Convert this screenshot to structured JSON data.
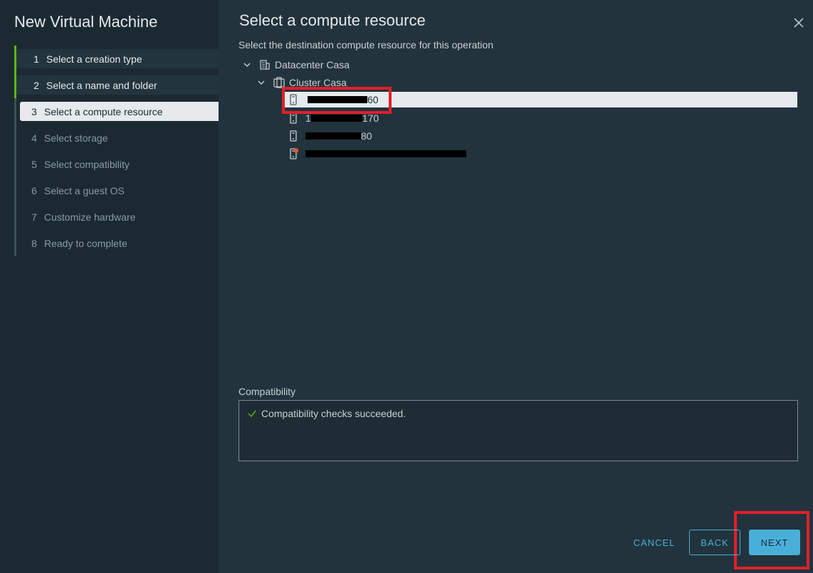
{
  "wizard": {
    "title": "New Virtual Machine",
    "steps": [
      {
        "num": "1",
        "label": "Select a creation type",
        "state": "done"
      },
      {
        "num": "2",
        "label": "Select a name and folder",
        "state": "done"
      },
      {
        "num": "3",
        "label": "Select a compute resource",
        "state": "current"
      },
      {
        "num": "4",
        "label": "Select storage",
        "state": "future"
      },
      {
        "num": "5",
        "label": "Select compatibility",
        "state": "future"
      },
      {
        "num": "6",
        "label": "Select a guest OS",
        "state": "future"
      },
      {
        "num": "7",
        "label": "Customize hardware",
        "state": "future"
      },
      {
        "num": "8",
        "label": "Ready to complete",
        "state": "future"
      }
    ]
  },
  "dialog": {
    "title": "Select a compute resource",
    "subtitle": "Select the destination compute resource for this operation",
    "close_icon": "close-icon"
  },
  "tree": {
    "datacenter": {
      "label": "Datacenter Casa",
      "icon": "datacenter-icon"
    },
    "cluster": {
      "label": "Cluster Casa",
      "icon": "cluster-icon"
    },
    "hosts": [
      {
        "visible_suffix": "60",
        "icon": "host-icon",
        "selected": true
      },
      {
        "visible_prefix": "1",
        "visible_suffix": "170",
        "icon": "host-icon",
        "selected": false
      },
      {
        "visible_suffix": "80",
        "icon": "host-icon",
        "selected": false
      },
      {
        "visible_suffix": "",
        "icon": "host-warning-icon",
        "selected": false
      }
    ]
  },
  "compatibility": {
    "label": "Compatibility",
    "message": "Compatibility checks succeeded.",
    "icon": "check-icon"
  },
  "buttons": {
    "cancel": "CANCEL",
    "back": "BACK",
    "next": "NEXT"
  },
  "colors": {
    "accent": "#49afd9",
    "done": "#60b515",
    "highlight": "#e0202a",
    "background": "#22333d",
    "sidebar": "#1b2a32"
  }
}
